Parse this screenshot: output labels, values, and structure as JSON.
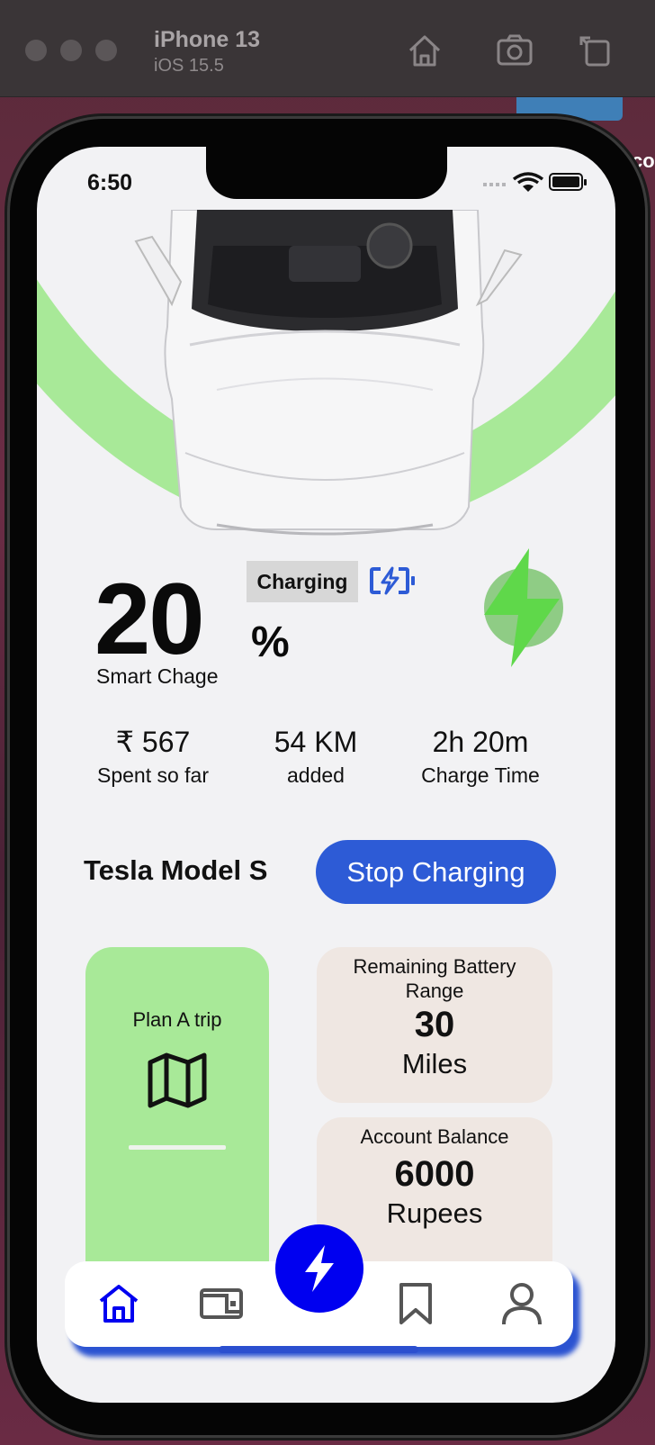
{
  "simulator": {
    "device": "iPhone 13",
    "os": "iOS 15.5"
  },
  "background_peek_text": "co",
  "status_bar": {
    "time": "6:50"
  },
  "charge": {
    "percent_value": "20",
    "percent_sign": "%",
    "status_badge": "Charging",
    "mode_label": "Smart Chage"
  },
  "stats": [
    {
      "value": "₹ 567",
      "label": "Spent so far"
    },
    {
      "value": "54 KM",
      "label": "added"
    },
    {
      "value": "2h 20m",
      "label": "Charge Time"
    }
  ],
  "vehicle": {
    "model": "Tesla Model S",
    "action_label": "Stop Charging"
  },
  "cards": {
    "trip": {
      "title": "Plan A trip"
    },
    "range": {
      "title": "Remaining Battery Range",
      "value": "30",
      "unit": "Miles"
    },
    "balance": {
      "title": "Account Balance",
      "value": "6000",
      "unit": "Rupees"
    }
  },
  "nav": {
    "items": [
      "home-icon",
      "wallet-icon",
      "charge-fab-icon",
      "bookmark-icon",
      "profile-icon"
    ],
    "active_color": "#0000f0",
    "inactive_color": "#555555"
  },
  "colors": {
    "accent_blue": "#2d5bd6",
    "green_arc": "#a8e998",
    "card_beige": "#efe7e2"
  }
}
